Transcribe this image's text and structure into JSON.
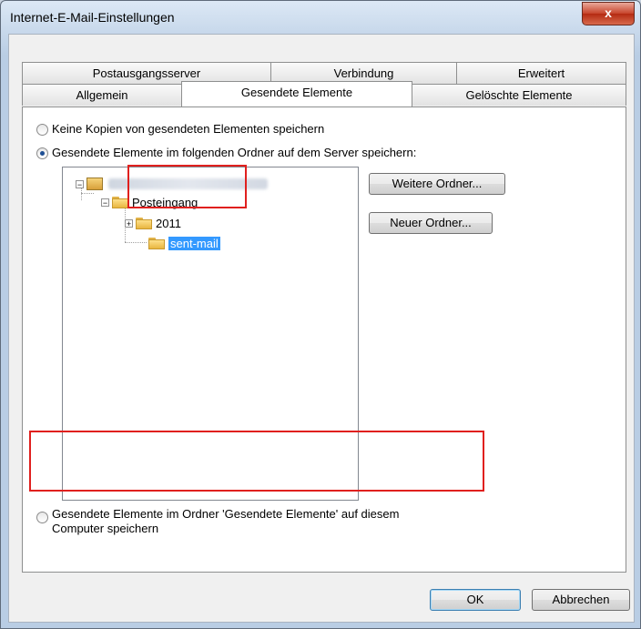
{
  "window": {
    "title": "Internet-E-Mail-Einstellungen",
    "close_glyph": "x"
  },
  "tabs_row1": [
    {
      "label": "Postausgangsserver"
    },
    {
      "label": "Verbindung"
    },
    {
      "label": "Erweitert"
    }
  ],
  "tabs_row2": [
    {
      "label": "Allgemein"
    },
    {
      "label": "Gesendete Elemente",
      "active": true
    },
    {
      "label": "Gelöschte Elemente"
    }
  ],
  "options": {
    "no_copies": "Keine Kopien von gesendeten Elementen speichern",
    "server_folder": "Gesendete Elemente im folgenden Ordner auf dem Server speichern:",
    "local_folder_line1": "Gesendete Elemente im Ordner 'Gesendete Elemente' auf diesem",
    "local_folder_line2": "Computer speichern"
  },
  "tree": {
    "root_expander": "−",
    "inbox": {
      "label": "Posteingang",
      "expander": "−"
    },
    "children": [
      {
        "label": "2011",
        "expander": "+"
      },
      {
        "label": "sent-mail",
        "selected": true
      }
    ]
  },
  "buttons": {
    "more_folders": "Weitere Ordner...",
    "new_folder": "Neuer Ordner...",
    "ok": "OK",
    "cancel": "Abbrechen"
  },
  "colors": {
    "highlight": "#3399ff",
    "annotation": "#e0201e"
  }
}
